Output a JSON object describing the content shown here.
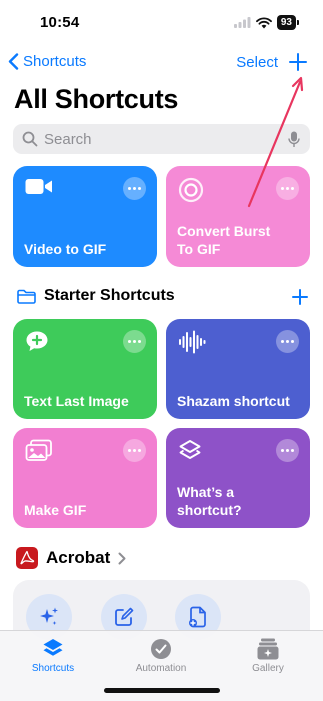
{
  "status": {
    "time": "10:54",
    "battery": "93"
  },
  "nav": {
    "back_label": "Shortcuts",
    "select_label": "Select"
  },
  "page": {
    "title": "All Shortcuts"
  },
  "search": {
    "placeholder": "Search"
  },
  "top_cards": [
    {
      "title": "Video to GIF",
      "icon": "video-camera-icon",
      "color": "#1e8bff"
    },
    {
      "title": "Convert Burst\nTo GIF",
      "icon": "burst-icon",
      "color": "#f58ad6"
    }
  ],
  "starter": {
    "title": "Starter Shortcuts",
    "cards": [
      {
        "title": "Text Last Image",
        "icon": "message-plus-icon",
        "color": "#3ecb5a"
      },
      {
        "title": "Shazam shortcut",
        "icon": "waveform-icon",
        "color": "#4d5fd0"
      },
      {
        "title": "Make GIF",
        "icon": "photos-icon",
        "color": "#f27fd1"
      },
      {
        "title": "What’s a\nshortcut?",
        "icon": "shortcuts-layers-icon",
        "color": "#8e52c8"
      }
    ]
  },
  "acrobat": {
    "title": "Acrobat",
    "icon": "adobe-acrobat-icon",
    "color": "#c8191e"
  },
  "tabs": [
    {
      "label": "Shortcuts",
      "icon": "shortcuts-layers-icon",
      "active": true
    },
    {
      "label": "Automation",
      "icon": "clock-check-icon",
      "active": false
    },
    {
      "label": "Gallery",
      "icon": "gallery-icon",
      "active": false
    }
  ],
  "colors": {
    "accent": "#0a7aff",
    "annotation_arrow": "#e8365f"
  }
}
